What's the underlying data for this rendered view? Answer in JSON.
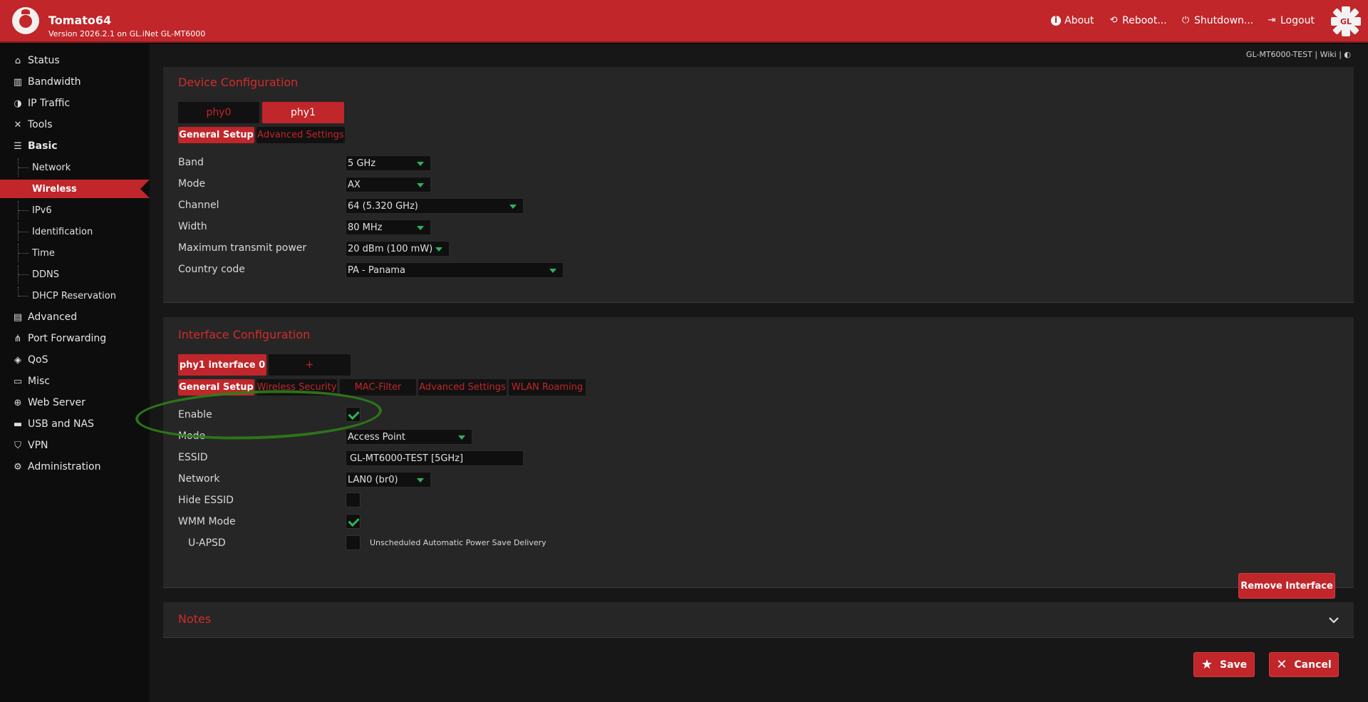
{
  "header": {
    "title": "Tomato64",
    "version": "Version 2026.2.1 on GL.iNet GL-MT6000",
    "nav": {
      "about": "About",
      "reboot": "Reboot...",
      "shutdown": "Shutdown...",
      "logout": "Logout"
    }
  },
  "topinfo": "GL-MT6000-TEST | Wiki | ◐",
  "sidebar": {
    "items": [
      {
        "label": "Status",
        "icon": "home-icon"
      },
      {
        "label": "Bandwidth",
        "icon": "bar-chart-icon"
      },
      {
        "label": "IP Traffic",
        "icon": "pie-chart-icon"
      },
      {
        "label": "Tools",
        "icon": "tools-icon"
      },
      {
        "label": "Basic",
        "icon": "server-icon"
      },
      {
        "label": "Advanced",
        "icon": "dashboard-icon"
      },
      {
        "label": "Port Forwarding",
        "icon": "network-icon"
      },
      {
        "label": "QoS",
        "icon": "tag-icon"
      },
      {
        "label": "Misc",
        "icon": "cast-icon"
      },
      {
        "label": "Web Server",
        "icon": "globe-icon"
      },
      {
        "label": "USB and NAS",
        "icon": "folder-icon"
      },
      {
        "label": "VPN",
        "icon": "shield-icon"
      },
      {
        "label": "Administration",
        "icon": "gear-icon"
      }
    ],
    "basic_sub": [
      "Network",
      "Wireless",
      "IPv6",
      "Identification",
      "Time",
      "DDNS",
      "DHCP Reservation"
    ]
  },
  "device_config": {
    "title": "Device Configuration",
    "phy_tabs": [
      "phy0",
      "phy1"
    ],
    "sub_tabs": [
      "General Setup",
      "Advanced Settings"
    ],
    "fields": {
      "band": {
        "label": "Band",
        "value": "5 GHz"
      },
      "mode": {
        "label": "Mode",
        "value": "AX"
      },
      "channel": {
        "label": "Channel",
        "value": "64 (5.320 GHz)"
      },
      "width": {
        "label": "Width",
        "value": "80 MHz"
      },
      "power": {
        "label": "Maximum transmit power",
        "value": "20 dBm (100 mW)"
      },
      "country": {
        "label": "Country code",
        "value": "PA - Panama"
      }
    }
  },
  "interface_config": {
    "title": "Interface Configuration",
    "iface_tabs": [
      "phy1 interface 0",
      "+"
    ],
    "sub_tabs": [
      "General Setup",
      "Wireless Security",
      "MAC-Filter",
      "Advanced Settings",
      "WLAN Roaming"
    ],
    "fields": {
      "enable": {
        "label": "Enable",
        "checked": true
      },
      "mode": {
        "label": "Mode",
        "value": "Access Point"
      },
      "essid": {
        "label": "ESSID",
        "value": "GL-MT6000-TEST [5GHz]"
      },
      "network": {
        "label": "Network",
        "value": "LAN0 (br0)"
      },
      "hide_essid": {
        "label": "Hide ESSID",
        "checked": false
      },
      "wmm": {
        "label": "WMM Mode",
        "checked": true
      },
      "uapsd": {
        "label": "U-APSD",
        "checked": false,
        "note": "Unscheduled Automatic Power Save Delivery"
      }
    },
    "remove_label": "Remove Interface"
  },
  "notes": {
    "title": "Notes"
  },
  "actions": {
    "save": "Save",
    "cancel": "Cancel"
  },
  "colors": {
    "accent": "#c0262a",
    "check": "#2db35a",
    "highlight_ellipse": "#2f7d1a"
  }
}
